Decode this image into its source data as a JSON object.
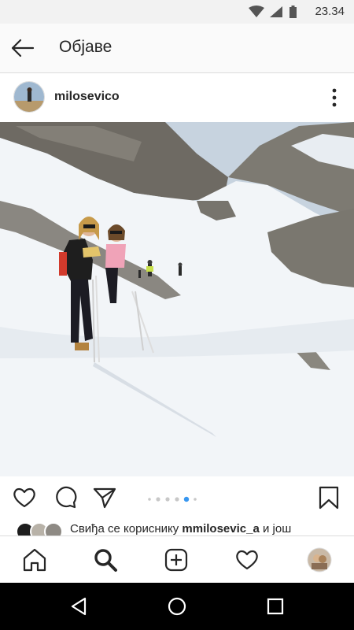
{
  "status_bar": {
    "time": "23.34",
    "icons": [
      "wifi-icon",
      "signal-icon",
      "battery-icon"
    ]
  },
  "app_bar": {
    "title": "Објаве",
    "back_icon": "arrow-left-icon"
  },
  "post": {
    "username": "milosevico",
    "carousel": {
      "count": 6,
      "active_index": 4
    },
    "likes": {
      "prefix": "Свиђа се кориснику ",
      "user": "mmilosevic_a",
      "suffix": " и још"
    }
  },
  "bottom_nav": [
    "home-icon",
    "search-icon",
    "add-post-icon",
    "heart-icon",
    "profile-avatar"
  ],
  "colors": {
    "accent": "#3897f0",
    "sky": "#c7d3df",
    "snow": "#f2f5f8"
  }
}
